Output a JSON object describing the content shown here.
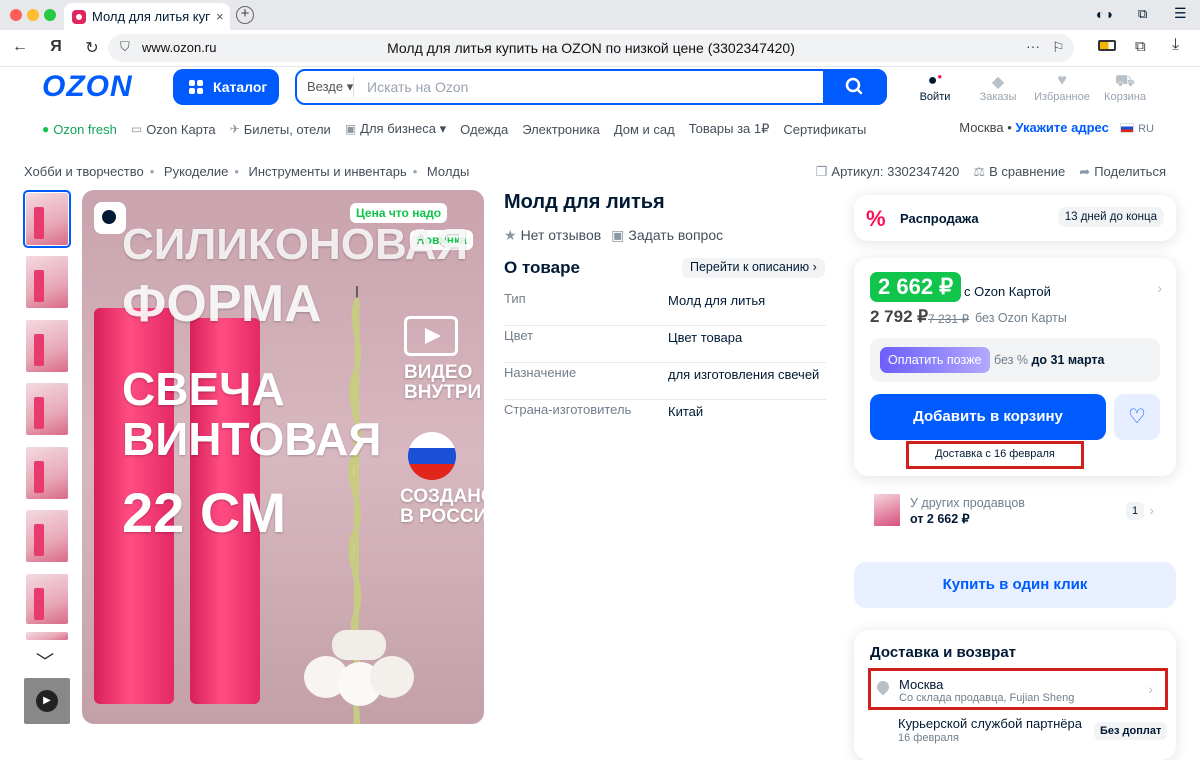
{
  "browser": {
    "tab_title": "Молд для литья купить",
    "tab_close": "×",
    "new_tab": "+",
    "host": "www.ozon.ru",
    "page_title": "Молд для литья купить на OZON по низкой цене (3302347420)"
  },
  "header": {
    "logo": "OZON",
    "catalog_label": "Каталог",
    "search_scope": "Везде ▾",
    "search_placeholder": "Искать на Ozon",
    "login_label": "Войти",
    "orders_label": "Заказы",
    "favorites_label": "Избранное",
    "cart_label": "Корзина"
  },
  "nav": {
    "links": [
      "Ozon fresh",
      "Ozon Карта",
      "Билеты, отели",
      "Для бизнеса ▾",
      "Одежда",
      "Электроника",
      "Дом и сад",
      "Товары за 1₽",
      "Сертификаты"
    ],
    "city": "Москва",
    "address_label": "Укажите адрес",
    "lang": "RU"
  },
  "breadcrumbs": [
    "Хобби и творчество",
    "Рукоделие",
    "Инструменты и инвентарь",
    "Молды"
  ],
  "meta": {
    "article": "Артикул: 3302347420",
    "compare": "В сравнение",
    "share": "Поделиться"
  },
  "image": {
    "badge_price": "Цена что надо",
    "badge_new": "Новинка",
    "line1": "СИЛИКОНОВАЯ",
    "line2": "ФОРМА",
    "line3": "СВЕЧА",
    "line4": "ВИНТОВАЯ",
    "line5": "22 СМ",
    "video1": "ВИДЕО",
    "video2": "ВНУТРИ",
    "made1": "СОЗДАНО",
    "made2": "В РОССИИ"
  },
  "product": {
    "title": "Молд для литья",
    "reviews": "Нет отзывов",
    "question": "Задать вопрос",
    "about": "О товаре",
    "goto_desc": "Перейти к описанию ›",
    "props": [
      {
        "k": "Тип",
        "v": "Молд для литья"
      },
      {
        "k": "Цвет",
        "v": "Цвет товара"
      },
      {
        "k": "Назначение",
        "v": "для изготовления свечей"
      },
      {
        "k": "Страна-изготовитель",
        "v": "Китай"
      }
    ]
  },
  "panel": {
    "sale_label": "Распродажа",
    "sale_days": "13 дней до конца",
    "price_card": "2 662 ₽",
    "with_card": "с Ozon Картой",
    "price": "2 792 ₽",
    "price_old": "7 231 ₽",
    "without_card": "без Ozon Карты",
    "pay_later": "Оплатить позже",
    "pay_no": "без %",
    "pay_until": "до 31 марта",
    "add_cart": "Добавить в корзину",
    "delivery": "Доставка с 16 февраля",
    "others_label": "У других продавцов",
    "others_price": "от 2 662 ₽",
    "others_count": "1",
    "one_click": "Купить в один клик",
    "delivery_title": "Доставка и возврат",
    "city": "Москва",
    "warehouse": "Со склада продавца, Fujian Sheng",
    "courier": "Курьерской службой партнёра",
    "courier_date": "16 февраля",
    "no_extra": "Без доплат"
  },
  "colors": {
    "brand": "#005bff",
    "green": "#10c44c",
    "sale": "#f91155",
    "highlight": "#d0201c"
  }
}
